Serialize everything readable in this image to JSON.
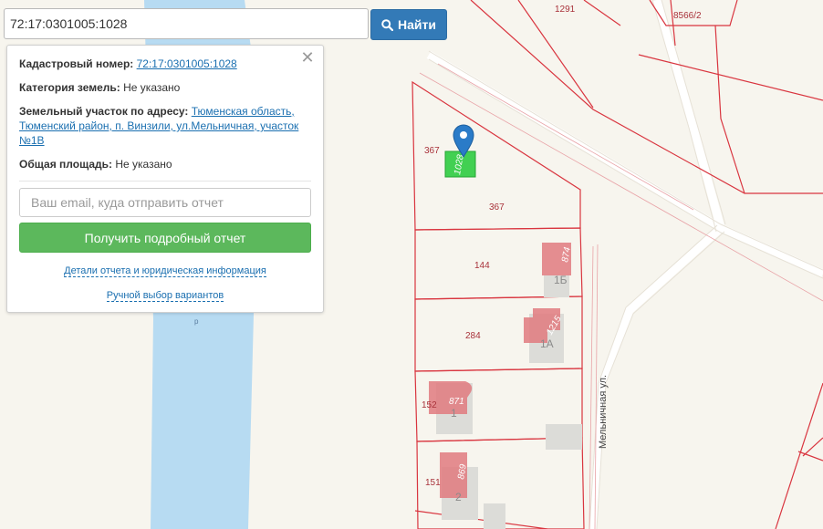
{
  "search": {
    "value": "72:17:0301005:1028",
    "button_label": "Найти"
  },
  "info_panel": {
    "cadastral_label": "Кадастровый номер:",
    "cadastral_value": "72:17:0301005:1028",
    "category_label": "Категория земель:",
    "category_value": "Не указано",
    "address_label": "Земельный участок по адресу:",
    "address_value": "Тюменская область, Тюменский район, п. Винзили, ул.Мельничная, участок №1В",
    "area_label": "Общая площадь:",
    "area_value": "Не указано",
    "email_placeholder": "Ваш email, куда отправить отчет",
    "report_button": "Получить подробный отчет",
    "details_link": "Детали отчета и юридическая информация",
    "manual_link": "Ручной выбор вариантов"
  },
  "map": {
    "parcel_labels": [
      "1291",
      "8566/2",
      "367",
      "367",
      "144",
      "284",
      "152",
      "151"
    ],
    "building_numbers": [
      "874",
      "1215",
      "871",
      "869",
      "1028"
    ],
    "house_numbers": [
      "1Б",
      "1А",
      "1",
      "2"
    ],
    "street_name": "Мельничная ул.",
    "river_label": "р",
    "colors": {
      "parcel_border": "#d9353f",
      "building_fill": "#e07a7f",
      "selected_parcel": "#2ecc40",
      "water": "#b7dbf2",
      "marker": "#2a7bc8"
    }
  }
}
